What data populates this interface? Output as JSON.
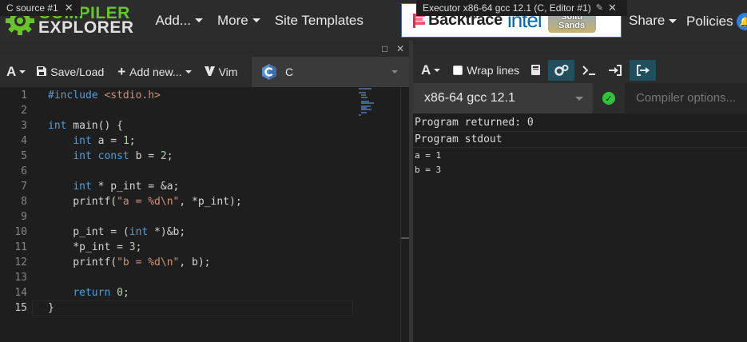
{
  "nav": {
    "logo_line1": "COMPILER",
    "logo_line2": "EXPLORER",
    "add": "Add...",
    "more": "More",
    "site_templates": "Site Templates",
    "share": "Share",
    "policies": "Policies"
  },
  "sponsors": {
    "backtrace": "Backtrace",
    "intel": "intel",
    "solid_line1": "Solid",
    "solid_line2": "Sands"
  },
  "source_pane": {
    "tab_title": "C source #1",
    "toolbar": {
      "font_button": "A",
      "save_load": "Save/Load",
      "add_new": "Add new...",
      "vim": "Vim"
    },
    "language": "C",
    "current_line": 15,
    "lines": [
      {
        "n": "1",
        "t": ""
      },
      {
        "n": "2",
        "t": ""
      },
      {
        "n": "3",
        "t": ""
      },
      {
        "n": "4",
        "t": ""
      },
      {
        "n": "5",
        "t": ""
      },
      {
        "n": "6",
        "t": ""
      },
      {
        "n": "7",
        "t": ""
      },
      {
        "n": "8",
        "t": ""
      },
      {
        "n": "9",
        "t": ""
      },
      {
        "n": "10",
        "t": ""
      },
      {
        "n": "11",
        "t": ""
      },
      {
        "n": "12",
        "t": ""
      },
      {
        "n": "13",
        "t": ""
      },
      {
        "n": "14",
        "t": ""
      },
      {
        "n": "15",
        "t": ""
      }
    ],
    "code": [
      [
        {
          "c": "kw",
          "t": "#include "
        },
        {
          "c": "str",
          "t": "<stdio.h>"
        }
      ],
      [],
      [
        {
          "c": "kw",
          "t": "int"
        },
        {
          "c": "",
          "t": " main() {"
        }
      ],
      [
        {
          "c": "",
          "t": "    "
        },
        {
          "c": "kw",
          "t": "int"
        },
        {
          "c": "",
          "t": " a = "
        },
        {
          "c": "num",
          "t": "1"
        },
        {
          "c": "",
          "t": ";"
        }
      ],
      [
        {
          "c": "",
          "t": "    "
        },
        {
          "c": "kw",
          "t": "int const"
        },
        {
          "c": "",
          "t": " b = "
        },
        {
          "c": "num",
          "t": "2"
        },
        {
          "c": "",
          "t": ";"
        }
      ],
      [],
      [
        {
          "c": "",
          "t": "    "
        },
        {
          "c": "kw",
          "t": "int"
        },
        {
          "c": "",
          "t": " * p_int = &a;"
        }
      ],
      [
        {
          "c": "",
          "t": "    printf("
        },
        {
          "c": "str",
          "t": "\"a = %d\\n\""
        },
        {
          "c": "",
          "t": ", *p_int);"
        }
      ],
      [],
      [
        {
          "c": "",
          "t": "    p_int = ("
        },
        {
          "c": "kw",
          "t": "int"
        },
        {
          "c": "",
          "t": " *)&b;"
        }
      ],
      [
        {
          "c": "",
          "t": "    *p_int = "
        },
        {
          "c": "num",
          "t": "3"
        },
        {
          "c": "",
          "t": ";"
        }
      ],
      [
        {
          "c": "",
          "t": "    printf("
        },
        {
          "c": "str",
          "t": "\"b = %d\\n\""
        },
        {
          "c": "",
          "t": ", b);"
        }
      ],
      [],
      [
        {
          "c": "",
          "t": "    "
        },
        {
          "c": "kw",
          "t": "return"
        },
        {
          "c": "",
          "t": " "
        },
        {
          "c": "num",
          "t": "0"
        },
        {
          "c": "",
          "t": ";"
        }
      ],
      [
        {
          "c": "",
          "t": "}"
        }
      ]
    ]
  },
  "executor_pane": {
    "tab_title": "Executor x86-64 gcc 12.1 (C, Editor #1)",
    "toolbar": {
      "font_button": "A",
      "wrap_lines": "Wrap lines"
    },
    "compiler": "x86-64 gcc 12.1",
    "compiler_options_placeholder": "Compiler options...",
    "output": {
      "returned": "Program returned: 0",
      "stdout_header": "Program stdout",
      "stdout_lines": [
        "a = 1",
        "b = 3"
      ]
    }
  },
  "colors": {
    "accent_green": "#67c52a",
    "keyword": "#569cd6",
    "string": "#ce9178",
    "number": "#b5cea8",
    "ok_status": "#2fc23a"
  }
}
